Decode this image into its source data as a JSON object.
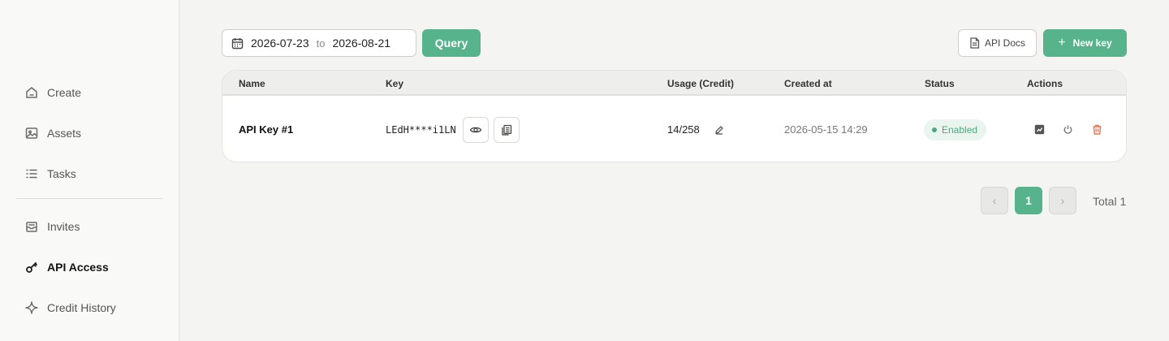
{
  "sidebar": {
    "items": [
      {
        "label": "Create",
        "icon": "home-icon"
      },
      {
        "label": "Assets",
        "icon": "image-icon"
      },
      {
        "label": "Tasks",
        "icon": "list-icon"
      },
      {
        "label": "Invites",
        "icon": "inbox-icon"
      },
      {
        "label": "API Access",
        "icon": "key-icon",
        "active": true
      },
      {
        "label": "Credit History",
        "icon": "sparkle-icon"
      }
    ]
  },
  "toolbar": {
    "date_from": "2026-07-23",
    "date_sep": "to",
    "date_to": "2026-08-21",
    "query_label": "Query",
    "docs_label": "API Docs",
    "new_key_label": "New key"
  },
  "table": {
    "headers": [
      "Name",
      "Key",
      "Usage (Credit)",
      "Created at",
      "Status",
      "Actions"
    ],
    "rows": [
      {
        "name": "API Key #1",
        "key": "LEdH****i1LN",
        "usage": "14/258",
        "created_at": "2026-05-15 14:29",
        "status": "Enabled"
      }
    ]
  },
  "pagination": {
    "current": "1",
    "total_label": "Total 1"
  },
  "colors": {
    "accent": "#57b38c",
    "status_enabled": "#4ea87f",
    "delete": "#e0785a"
  }
}
